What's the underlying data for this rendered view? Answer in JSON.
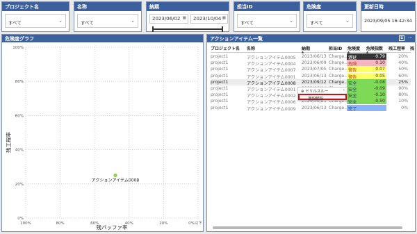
{
  "slicers": {
    "project": {
      "title": "プロジェクト名",
      "value": "すべて"
    },
    "name": {
      "title": "名称",
      "value": "すべて"
    },
    "due": {
      "title": "納期",
      "start": "2023/06/02",
      "end": "2023/10/04"
    },
    "owner": {
      "title": "担当ID",
      "value": "すべて"
    },
    "risk": {
      "title": "危険度",
      "value": "すべて"
    },
    "updated": {
      "title": "更新日時",
      "value": "2023/09/05 16:42:34"
    }
  },
  "graph": {
    "title": "危険度グラフ",
    "xlabel": "残バッファ率",
    "ylabel": "残工程率",
    "xticks": [
      "100%",
      "80%",
      "60%",
      "40%",
      "20%",
      "0%以下"
    ],
    "yticks": [
      "100%",
      "80%",
      "60%",
      "40%",
      "20%",
      "0%"
    ],
    "point_label": "アクションアイテム0008",
    "point_color": "#8fd14f"
  },
  "chart_data": {
    "type": "scatter",
    "xlabel": "残バッファ率",
    "ylabel": "残工程率",
    "x_axis": "reversed",
    "xlim": [
      0,
      100
    ],
    "ylim": [
      0,
      100
    ],
    "grid": true,
    "points": [
      {
        "label": "アクションアイテム0008",
        "x": 48,
        "y": 25
      }
    ]
  },
  "table": {
    "title": "アクションアイテム一覧",
    "headers": [
      "プロジェクト名",
      "名称",
      "納期",
      "担当ID",
      "危険度",
      "危険指数",
      "残工程率",
      "残"
    ],
    "sort_glyph": "▲",
    "rows": [
      [
        "project1",
        "アクションアイテム0005",
        "2023/06/13",
        "Charge...",
        "遅延",
        "0.79",
        "20%"
      ],
      [
        "project1",
        "アクションアイテム0004",
        "2023/06/09",
        "Charge...",
        "危険",
        "0.10",
        "40%"
      ],
      [
        "project1",
        "アクションアイテム0007",
        "2023/07/05",
        "Charge...",
        "警告",
        "0.07",
        "50%"
      ],
      [
        "project1",
        "アクションアイテム0001",
        "2023/06/13",
        "Charge...",
        "警告",
        "0.05",
        "60%"
      ],
      [
        "project1",
        "アクションアイテム0008",
        "2023/09/12",
        "Charge...",
        "安全",
        "-0.08",
        "25%"
      ],
      [
        "project1",
        "アクションアイテム0001",
        "2023/06/14",
        "Charge...",
        "安全",
        "-0.09",
        "90%"
      ],
      [
        "project1",
        "アクションアイテム0002",
        "2023/06/14",
        "Charge...",
        "安全",
        "-0.10",
        "80%"
      ],
      [
        "project1",
        "アクションアイテム0006",
        "2023/06/23",
        "Charge...",
        "安全",
        "-0.50",
        "10%"
      ],
      [
        "project1",
        "アクションアイテム0009",
        "2023/06/13",
        "Charge...",
        "完了",
        "",
        "0%"
      ]
    ],
    "risk_colors": {
      "遅延": "#333333",
      "危険": "#f4b6c2",
      "警告": "#ffff66",
      "安全": "#7ed957",
      "完了": "#8ab4f8"
    },
    "context_menu": [
      "ドリルスルー",
      "選択解除"
    ]
  }
}
